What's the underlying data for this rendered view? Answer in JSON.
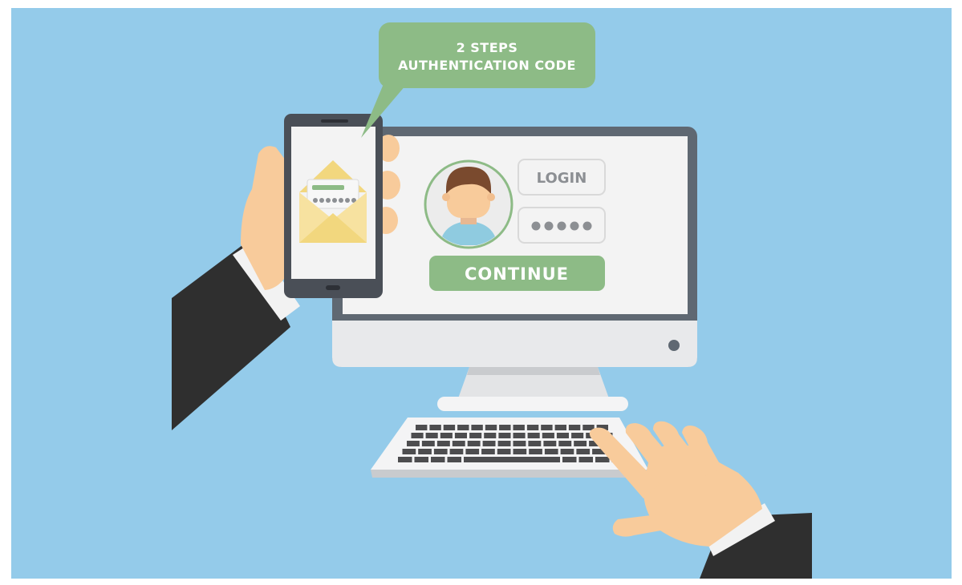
{
  "bubble": {
    "line1": "2 STEPS",
    "line2": "AUTHENTICATION CODE"
  },
  "login_form": {
    "login_label": "LOGIN",
    "password_mask": "●●●●●",
    "continue_label": "CONTINUE"
  },
  "colors": {
    "background": "#94CBEA",
    "accent_green": "#8DBB86",
    "monitor_frame": "#5F6872",
    "screen": "#F3F3F3",
    "envelope": "#F2D77E",
    "skin": "#F8CB9B",
    "sleeve": "#2F2F2F"
  },
  "icons": [
    "envelope-icon",
    "avatar-icon"
  ]
}
